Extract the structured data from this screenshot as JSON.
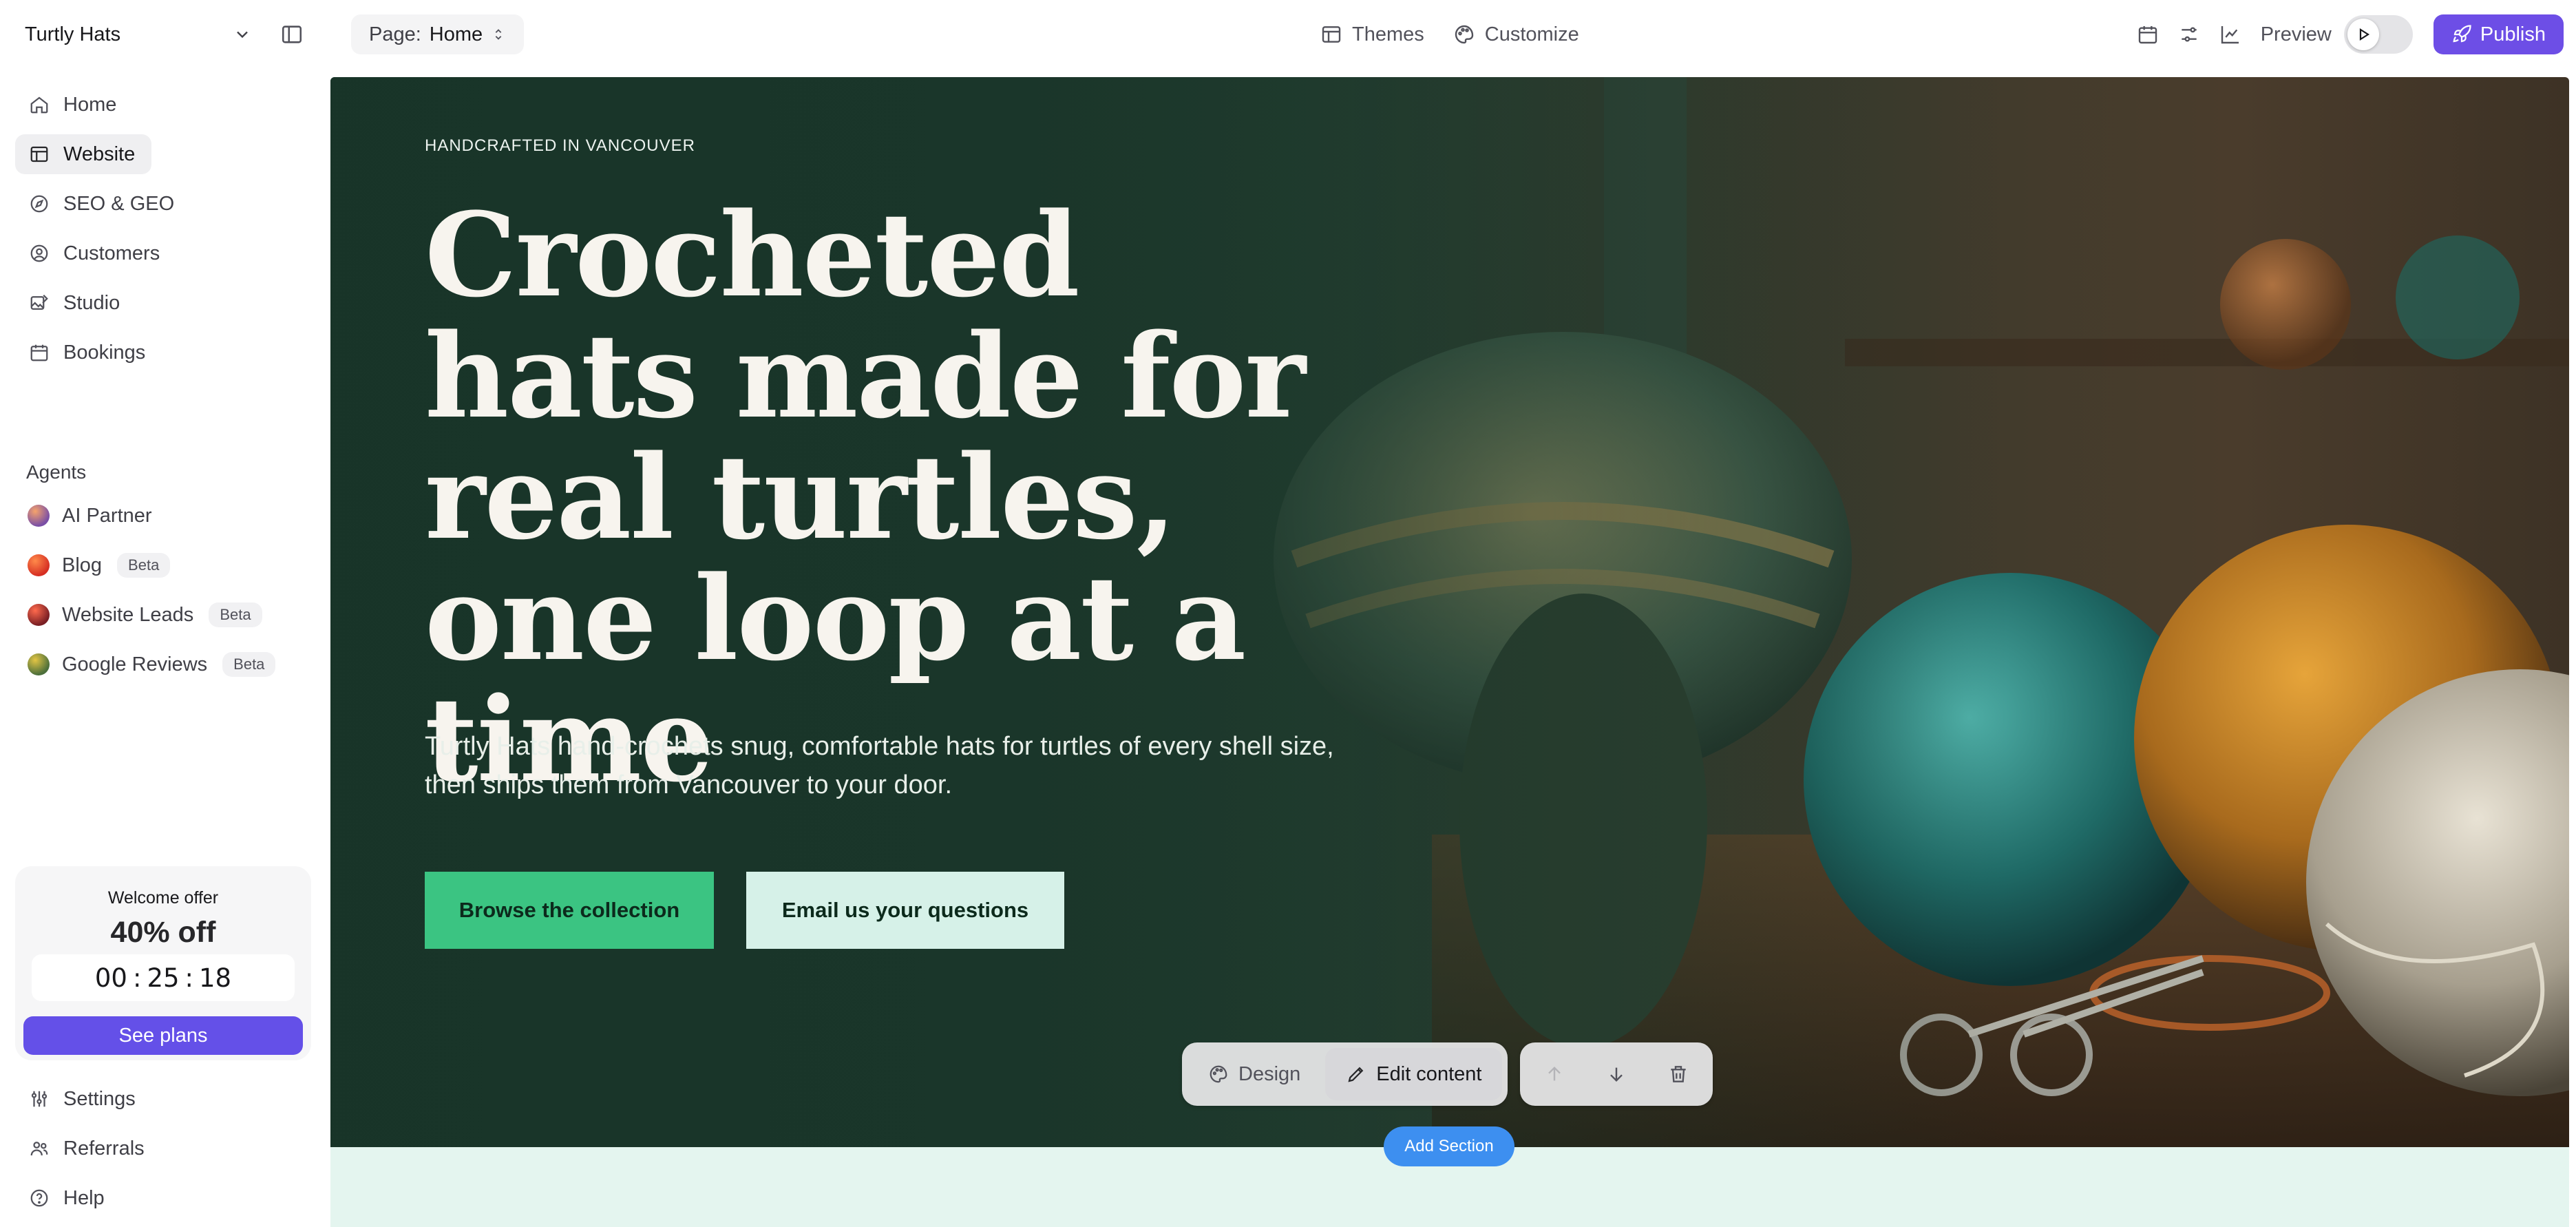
{
  "app": {
    "site_name": "Turtly Hats",
    "page_prefix": "Page:",
    "page_name": "Home",
    "themes_label": "Themes",
    "customize_label": "Customize",
    "preview_label": "Preview",
    "publish_label": "Publish",
    "accent_color": "#6d4ee6"
  },
  "sidebar": {
    "items": [
      {
        "label": "Home",
        "icon": "home-icon"
      },
      {
        "label": "Website",
        "icon": "layout-icon",
        "active": true
      },
      {
        "label": "SEO & GEO",
        "icon": "compass-icon"
      },
      {
        "label": "Customers",
        "icon": "user-circle-icon"
      },
      {
        "label": "Studio",
        "icon": "image-edit-icon"
      },
      {
        "label": "Bookings",
        "icon": "calendar-icon"
      }
    ],
    "agents_label": "Agents",
    "agents": [
      {
        "label": "AI Partner",
        "badge": "",
        "color": "#8a5a9e"
      },
      {
        "label": "Blog",
        "badge": "Beta",
        "color": "#e0502f"
      },
      {
        "label": "Website Leads",
        "badge": "Beta",
        "color": "#c03a2f"
      },
      {
        "label": "Google Reviews",
        "badge": "Beta",
        "color": "#b59a2a"
      }
    ],
    "offer": {
      "title": "Welcome offer",
      "value": "40% off",
      "timer": {
        "hours": "00",
        "minutes": "25",
        "seconds": "18"
      },
      "button": "See plans"
    },
    "footer": [
      {
        "label": "Settings",
        "icon": "settings-sliders-icon"
      },
      {
        "label": "Referrals",
        "icon": "users-icon"
      },
      {
        "label": "Help",
        "icon": "help-circle-icon"
      }
    ]
  },
  "hero": {
    "eyebrow": "HANDCRAFTED IN VANCOUVER",
    "headline": "Crocheted hats made for real turtles, one loop at a time",
    "subheadline": "Turtly Hats hand-crochets snug, comfortable hats for turtles of every shell size, then ships them from Vancouver to your door.",
    "cta_primary": "Browse the collection",
    "cta_secondary": "Email us your questions",
    "primary_color": "#3bc482"
  },
  "editor": {
    "design_label": "Design",
    "edit_content_label": "Edit content",
    "add_section_label": "Add Section"
  }
}
